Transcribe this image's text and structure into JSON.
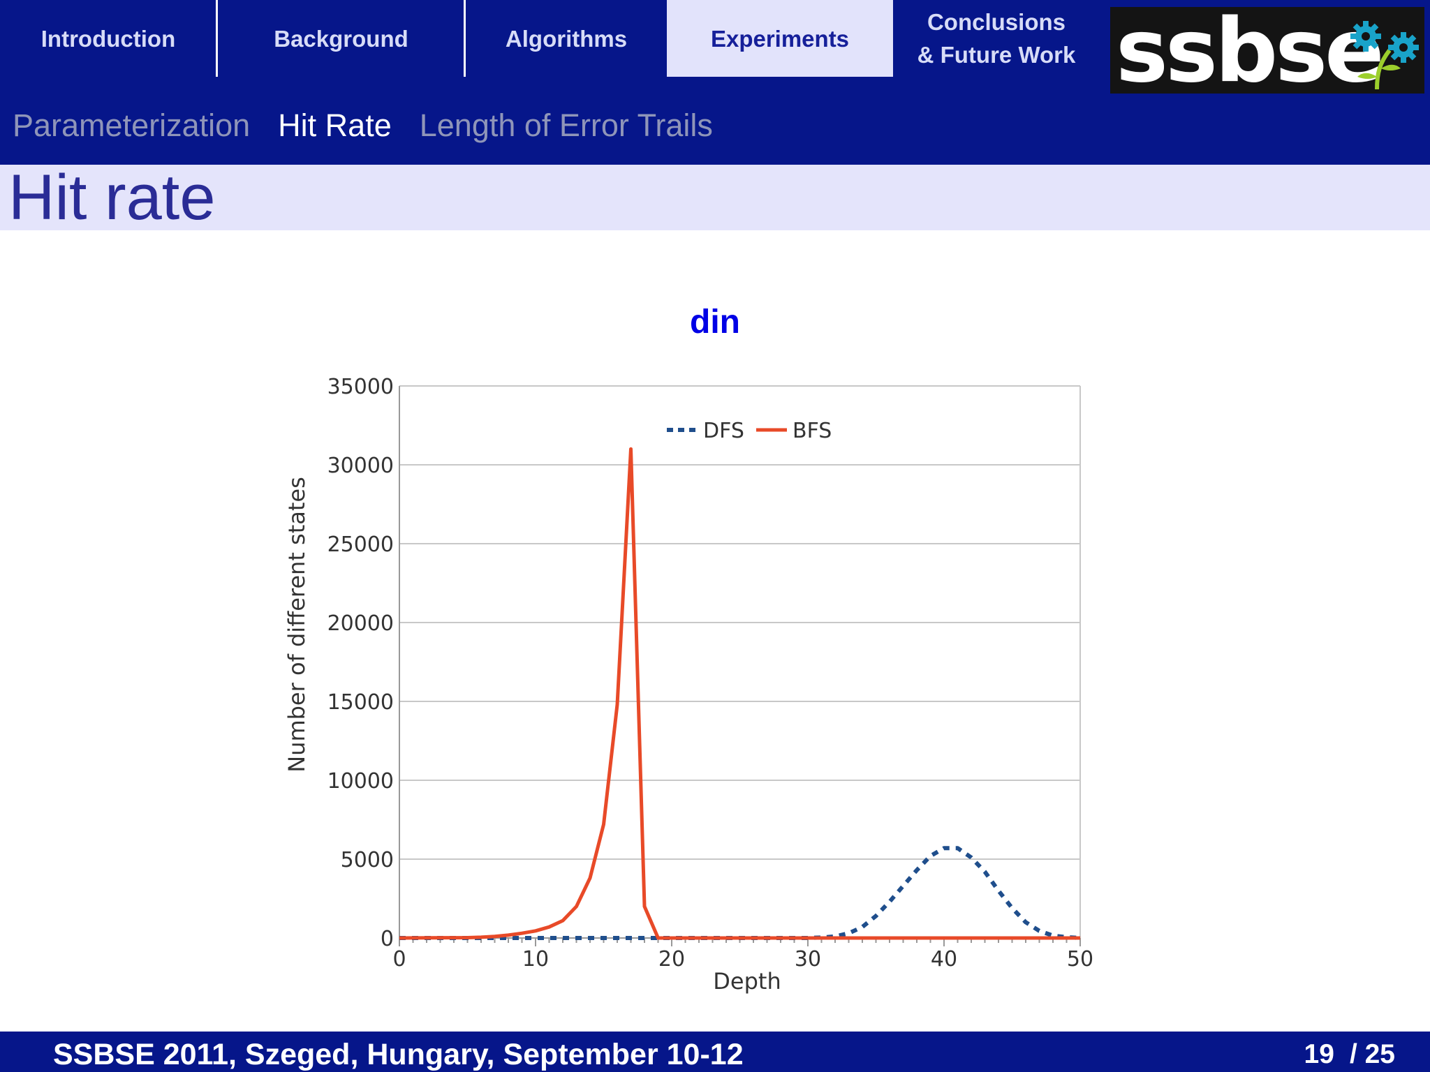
{
  "nav": {
    "tabs": [
      {
        "label": "Introduction"
      },
      {
        "label": "Background"
      },
      {
        "label": "Algorithms"
      },
      {
        "label": "Experiments",
        "active": true
      },
      {
        "label": "Conclusions\n& Future Work"
      }
    ],
    "logo_text": "ssbse"
  },
  "subnav": {
    "items": [
      "Parameterization",
      "Hit Rate",
      "Length of Error Trails"
    ],
    "active": "Hit Rate"
  },
  "page_title": "Hit rate",
  "chart_data": {
    "type": "line",
    "title": "din",
    "xlabel": "Depth",
    "ylabel": "Number of different states",
    "xlim": [
      0,
      50
    ],
    "ylim": [
      0,
      35000
    ],
    "xticks": [
      0,
      10,
      20,
      30,
      40,
      50
    ],
    "yticks": [
      0,
      5000,
      10000,
      15000,
      20000,
      25000,
      30000,
      35000
    ],
    "grid": true,
    "legend_position": "top-center",
    "series": [
      {
        "name": "DFS",
        "style": "dashed",
        "color": "#1f4e8c",
        "x": [
          0,
          30,
          31,
          32,
          33,
          34,
          35,
          36,
          37,
          38,
          39,
          40,
          41,
          42,
          43,
          44,
          45,
          46,
          47,
          48,
          49,
          50
        ],
        "y": [
          0,
          0,
          30,
          100,
          300,
          700,
          1400,
          2300,
          3300,
          4300,
          5200,
          5700,
          5700,
          5100,
          4200,
          3000,
          1900,
          1000,
          450,
          150,
          50,
          0
        ]
      },
      {
        "name": "BFS",
        "style": "solid",
        "color": "#e84a28",
        "x": [
          0,
          5,
          6,
          7,
          8,
          9,
          10,
          11,
          12,
          13,
          14,
          15,
          16,
          17,
          18,
          19,
          20,
          50
        ],
        "y": [
          0,
          20,
          50,
          100,
          180,
          300,
          450,
          700,
          1100,
          2000,
          3800,
          7200,
          14800,
          31000,
          2000,
          0,
          0,
          0
        ]
      }
    ]
  },
  "footer": {
    "text": "SSBSE 2011, Szeged, Hungary, September 10-12",
    "page": "19",
    "total": "/ 25"
  },
  "colors": {
    "nav_bg": "#06168a",
    "active_tab_bg": "#e2e3fb",
    "title_bar_bg": "#e4e4fb",
    "title_color": "#2a2c96",
    "chart_title_color": "#0000e6"
  }
}
